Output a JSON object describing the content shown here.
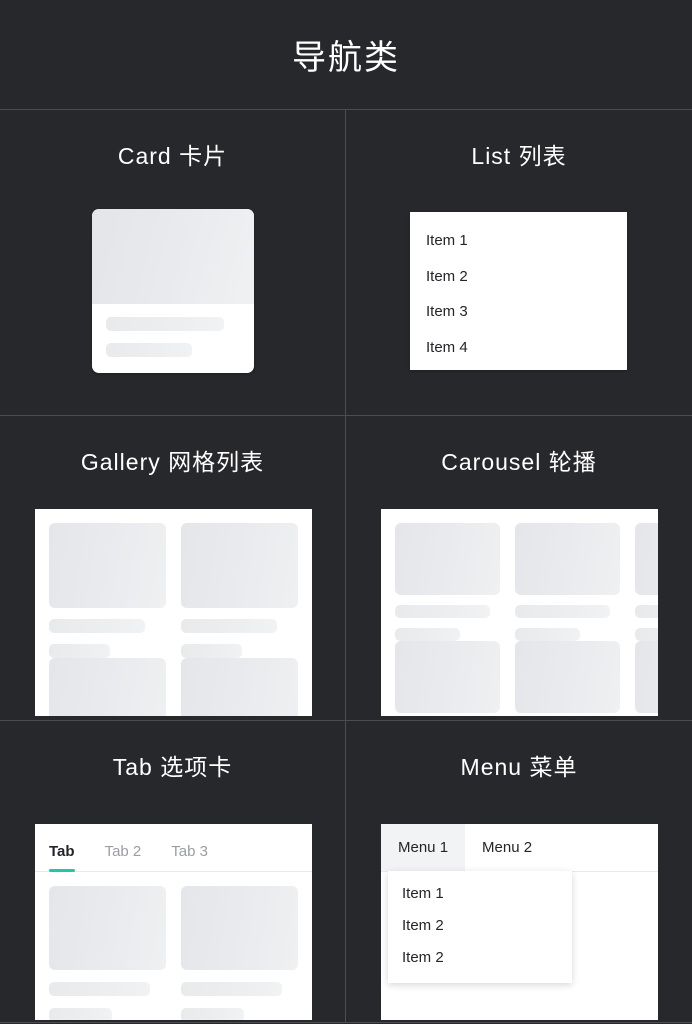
{
  "header": {
    "title": "导航类"
  },
  "theme": {
    "background": "#26282c",
    "divider": "#4a4d52",
    "panel": "#ffffff",
    "text_on_dark": "#ffffff",
    "text_dark": "#23252a",
    "text_muted": "#9a9da3",
    "accent": "#1fc9a8",
    "placeholder": "#e8eaec",
    "menu_active_bg": "#f2f3f5"
  },
  "sections": [
    {
      "key": "card",
      "title": "Card 卡片",
      "type": "card",
      "card": {
        "lines": 2
      }
    },
    {
      "key": "list",
      "title": "List  列表",
      "type": "list",
      "items": [
        "Item 1",
        "Item 2",
        "Item 3",
        "Item 4"
      ]
    },
    {
      "key": "gallery",
      "title": "Gallery 网格列表",
      "type": "gallery",
      "columns": 2,
      "tiles": 4
    },
    {
      "key": "carousel",
      "title": "Carousel  轮播",
      "type": "carousel",
      "columns": 3,
      "tiles": 6
    },
    {
      "key": "tab",
      "title": "Tab 选项卡",
      "type": "tab",
      "tabs": [
        {
          "label": "Tab",
          "active": true
        },
        {
          "label": "Tab 2",
          "active": false
        },
        {
          "label": "Tab 3",
          "active": false
        }
      ],
      "tiles": 2
    },
    {
      "key": "menu",
      "title": "Menu  菜单",
      "type": "menu",
      "top_items": [
        {
          "label": "Menu 1",
          "active": true
        },
        {
          "label": "Menu 2",
          "active": false
        }
      ],
      "dropdown_items": [
        "Item 1",
        "Item 2",
        "Item 2"
      ]
    }
  ]
}
